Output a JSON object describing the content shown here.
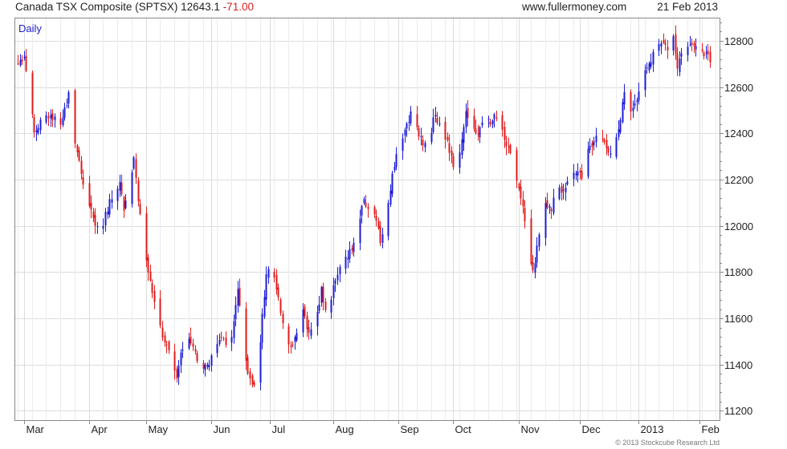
{
  "header": {
    "instrument": "Canada TSX Composite (SPTSX)",
    "last": "12643.1",
    "change": "-71.00",
    "website": "www.fullermoney.com",
    "date": "21 Feb 2013"
  },
  "copyright": "© 2013 Stockcube Research Ltd",
  "colors": {
    "up": "#1c1cd6",
    "down": "#e01b1b",
    "grid": "#dcdcdc",
    "frame": "#888888",
    "label": "#1c1cc8"
  },
  "chart_data": {
    "type": "candlestick",
    "period_label": "Daily",
    "ylim": [
      11160,
      12900
    ],
    "y_ticks": [
      11200,
      11400,
      11600,
      11800,
      12000,
      12200,
      12400,
      12600,
      12800
    ],
    "x_ticks": [
      {
        "label": "Mar",
        "day": 3
      },
      {
        "label": "Apr",
        "day": 35
      },
      {
        "label": "May",
        "day": 63
      },
      {
        "label": "Jun",
        "day": 95
      },
      {
        "label": "Jul",
        "day": 124
      },
      {
        "label": "Aug",
        "day": 155
      },
      {
        "label": "Sep",
        "day": 187
      },
      {
        "label": "Oct",
        "day": 214
      },
      {
        "label": "Nov",
        "day": 246
      },
      {
        "label": "Dec",
        "day": 276
      },
      {
        "label": "2013",
        "day": 305
      },
      {
        "label": "Feb",
        "day": 335
      }
    ],
    "series_anchors": [
      [
        0,
        12700
      ],
      [
        3,
        12740
      ],
      [
        8,
        12400
      ],
      [
        13,
        12480
      ],
      [
        18,
        12470
      ],
      [
        22,
        12450
      ],
      [
        25,
        12580
      ],
      [
        27,
        12400
      ],
      [
        33,
        12150
      ],
      [
        40,
        11960
      ],
      [
        45,
        12100
      ],
      [
        50,
        12180
      ],
      [
        52,
        12080
      ],
      [
        55,
        12200
      ],
      [
        57,
        12300
      ],
      [
        59,
        12100
      ],
      [
        62,
        11900
      ],
      [
        65,
        11750
      ],
      [
        70,
        11560
      ],
      [
        75,
        11420
      ],
      [
        78,
        11330
      ],
      [
        80,
        11450
      ],
      [
        83,
        11550
      ],
      [
        86,
        11470
      ],
      [
        90,
        11380
      ],
      [
        95,
        11420
      ],
      [
        100,
        11530
      ],
      [
        103,
        11440
      ],
      [
        106,
        11580
      ],
      [
        108,
        11720
      ],
      [
        111,
        11480
      ],
      [
        113,
        11380
      ],
      [
        116,
        11310
      ],
      [
        118,
        11400
      ],
      [
        120,
        11620
      ],
      [
        122,
        11800
      ],
      [
        125,
        11840
      ],
      [
        128,
        11680
      ],
      [
        131,
        11550
      ],
      [
        134,
        11480
      ],
      [
        137,
        11540
      ],
      [
        140,
        11640
      ],
      [
        143,
        11520
      ],
      [
        146,
        11590
      ],
      [
        149,
        11720
      ],
      [
        152,
        11620
      ],
      [
        155,
        11740
      ],
      [
        158,
        11820
      ],
      [
        161,
        11870
      ],
      [
        164,
        11890
      ],
      [
        167,
        12000
      ],
      [
        170,
        12100
      ],
      [
        173,
        12060
      ],
      [
        176,
        12020
      ],
      [
        178,
        11920
      ],
      [
        181,
        12010
      ],
      [
        184,
        12220
      ],
      [
        187,
        12340
      ],
      [
        190,
        12400
      ],
      [
        193,
        12500
      ],
      [
        196,
        12420
      ],
      [
        199,
        12360
      ],
      [
        202,
        12390
      ],
      [
        205,
        12480
      ],
      [
        208,
        12430
      ],
      [
        211,
        12360
      ],
      [
        214,
        12250
      ],
      [
        217,
        12330
      ],
      [
        220,
        12480
      ],
      [
        223,
        12430
      ],
      [
        226,
        12400
      ],
      [
        229,
        12480
      ],
      [
        232,
        12440
      ],
      [
        235,
        12480
      ],
      [
        238,
        12420
      ],
      [
        241,
        12330
      ],
      [
        244,
        12240
      ],
      [
        247,
        12130
      ],
      [
        249,
        12020
      ],
      [
        251,
        11850
      ],
      [
        253,
        11790
      ],
      [
        256,
        11950
      ],
      [
        259,
        12110
      ],
      [
        262,
        12060
      ],
      [
        265,
        12190
      ],
      [
        268,
        12140
      ],
      [
        271,
        12200
      ],
      [
        274,
        12240
      ],
      [
        277,
        12200
      ],
      [
        280,
        12330
      ],
      [
        283,
        12370
      ],
      [
        286,
        12390
      ],
      [
        289,
        12340
      ],
      [
        292,
        12320
      ],
      [
        295,
        12400
      ],
      [
        298,
        12580
      ],
      [
        301,
        12500
      ],
      [
        304,
        12560
      ],
      [
        307,
        12640
      ],
      [
        310,
        12700
      ],
      [
        313,
        12780
      ],
      [
        316,
        12800
      ],
      [
        319,
        12770
      ],
      [
        322,
        12820
      ],
      [
        324,
        12700
      ],
      [
        327,
        12770
      ],
      [
        330,
        12800
      ],
      [
        333,
        12770
      ],
      [
        336,
        12770
      ],
      [
        339,
        12720
      ],
      [
        342,
        12640
      ]
    ]
  }
}
